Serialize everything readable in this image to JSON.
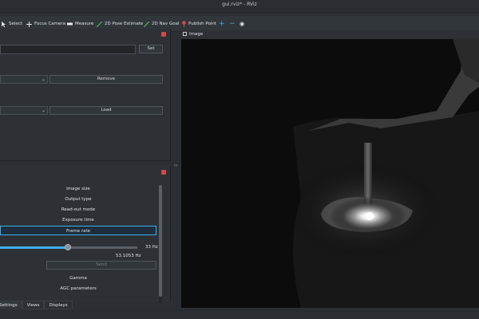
{
  "window": {
    "title": "gui.rviz* - RViz"
  },
  "toolbar": {
    "select_label": "Select",
    "focus_camera_label": "Focus Camera",
    "measure_label": "Measure",
    "pose_estimate_label": "2D Pose Estimate",
    "nav_goal_label": "2D Nav Goal",
    "publish_point_label": "Publish Point",
    "plus_symbol": "+",
    "minus_symbol": "−",
    "eye_symbol": "◉"
  },
  "top_panel": {
    "set_button": "Set",
    "remove_button": "Remove",
    "load_button": "Load"
  },
  "settings_panel": {
    "properties": [
      "Image size",
      "Output type",
      "Read-out mode",
      "Exposure time",
      "Frame rate"
    ],
    "selected_index": 4,
    "slider": {
      "max_label": "33 Hz",
      "value_label": "53.1053 Hz",
      "position_fraction": 0.49
    },
    "send_button": "Send",
    "properties_after": [
      "Gamma",
      "AGC parameters"
    ]
  },
  "tabs": [
    "Settings",
    "Views",
    "Displays"
  ],
  "splitter_arrows": "‹›",
  "image_panel": {
    "title": "Image"
  },
  "colors": {
    "accent": "#3daee9",
    "close": "#d04a4a",
    "background": "#2b2f33"
  }
}
